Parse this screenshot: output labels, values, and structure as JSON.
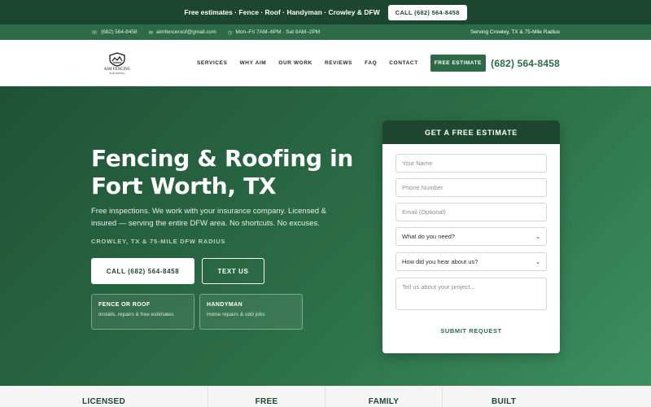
{
  "announce": {
    "text": "Free estimates · Fence · Roof · Handyman · Crowley & DFW",
    "call_label": "CALL (682) 564-8458"
  },
  "infobar": {
    "phone": "(682) 564-8458",
    "email": "aimfenceroof@gmail.com",
    "hours": "Mon–Fri 7AM–6PM · Sat 8AM–2PM",
    "service_area": "Serving Crowley, TX & 75-Mile Radius",
    "icons": [
      "phone-icon",
      "mail-icon",
      "clock-icon"
    ]
  },
  "nav": {
    "logo_text": "AIM FENCING",
    "logo_subtext": "& ROOFING",
    "items": [
      {
        "label": "SERVICES"
      },
      {
        "label": "WHY AIM"
      },
      {
        "label": "OUR WORK"
      },
      {
        "label": "REVIEWS"
      },
      {
        "label": "FAQ"
      },
      {
        "label": "CONTACT"
      }
    ],
    "cta_label": "FREE ESTIMATE",
    "phone": "(682) 564-8458"
  },
  "hero": {
    "title": "Fencing & Roofing in Fort Worth, TX",
    "description": "Free inspections. We work with your insurance company. Licensed & insured — serving the entire DFW area. No shortcuts. No excuses.",
    "location": "CROWLEY, TX & 75-MILE DFW RADIUS",
    "call_button": "CALL (682) 564-8458",
    "text_button": "TEXT US",
    "cards": [
      {
        "title": "FENCE OR ROOF",
        "subtitle": "Installs, repairs & free estimates"
      },
      {
        "title": "HANDYMAN",
        "subtitle": "Home repairs & odd jobs"
      }
    ]
  },
  "form": {
    "title": "GET A FREE ESTIMATE",
    "name_placeholder": "Your Name",
    "phone_placeholder": "Phone Number",
    "email_placeholder": "Email (Optional)",
    "need_select": "What do you need?",
    "hear_select": "How did you hear about us?",
    "project_placeholder": "Tell us about your project...",
    "submit_label": "SUBMIT REQUEST"
  },
  "stats": [
    {
      "label": "LICENSED"
    },
    {
      "label": "FREE"
    },
    {
      "label": "FAMILY"
    },
    {
      "label": "BUILT"
    }
  ],
  "colors": {
    "brand_dark": "#1d4630",
    "brand": "#2d6b48",
    "hero_light": "#3d8f62"
  }
}
